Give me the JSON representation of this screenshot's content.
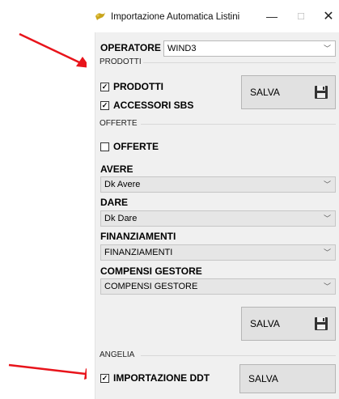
{
  "window": {
    "title": "Importazione Automatica Listini",
    "minimize_glyph": "—",
    "maximize_glyph": "☐",
    "close_glyph": "✕"
  },
  "operatore": {
    "label": "OPERATORE",
    "value": "WIND3"
  },
  "prodotti": {
    "group_label": "PRODOTTI",
    "checkbox_prodotti": "PRODOTTI",
    "checkbox_accessori": "ACCESSORI SBS",
    "checked_prodotti": true,
    "checked_accessori": true,
    "save_label": "SALVA"
  },
  "offerte": {
    "group_label": "OFFERTE",
    "checkbox_offerte": "OFFERTE",
    "checked_offerte": false,
    "avere_label": "AVERE",
    "avere_value": "Dk Avere",
    "dare_label": "DARE",
    "dare_value": "Dk Dare",
    "finanziamenti_label": "FINANZIAMENTI",
    "finanziamenti_value": "FINANZIAMENTI",
    "compensi_label": "COMPENSI GESTORE",
    "compensi_value": "COMPENSI GESTORE",
    "save_label": "SALVA"
  },
  "angelia": {
    "group_label": "ANGELIA",
    "checkbox_ddt": "IMPORTAZIONE  DDT",
    "checked_ddt": true,
    "save_label": "SALVA"
  },
  "glyphs": {
    "checked": "✓",
    "dropdown": "﹀"
  },
  "colors": {
    "annotation_arrow": "#e8141b",
    "client_bg": "#f0f0f0",
    "button_bg": "#e1e1e1"
  }
}
